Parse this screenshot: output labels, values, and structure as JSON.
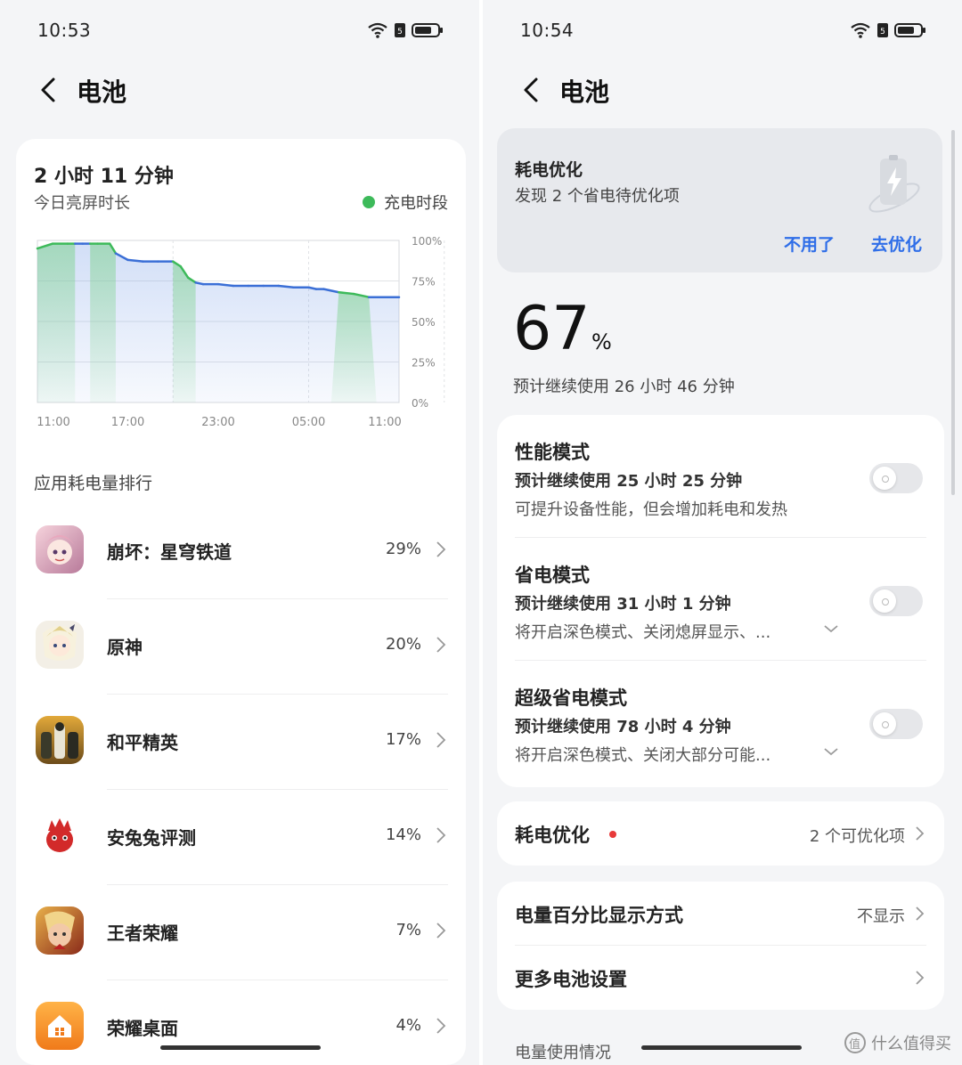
{
  "left": {
    "status": {
      "time": "10:53"
    },
    "header": {
      "title": "电池"
    },
    "usage": {
      "screen_time": "2 小时 11 分钟",
      "screen_time_label": "今日亮屏时长",
      "legend_label": "充电时段",
      "legend_color": "#3dba5a"
    },
    "chart_data": {
      "type": "area",
      "x_ticks": [
        "11:00",
        "17:00",
        "23:00",
        "05:00",
        "11:00"
      ],
      "y_ticks": [
        "100%",
        "75%",
        "50%",
        "25%",
        "0%"
      ],
      "ylim": [
        0,
        100
      ],
      "x": [
        0,
        1,
        2,
        2.5,
        3,
        3.5,
        4,
        4.8,
        5.2,
        6,
        7,
        8,
        9,
        9.5,
        10,
        10.5,
        11,
        12,
        13,
        14,
        15,
        16,
        17,
        18,
        18.5,
        19,
        20,
        21,
        22,
        23,
        24
      ],
      "values": [
        95,
        98,
        98,
        98,
        98,
        98,
        98,
        98,
        92,
        88,
        87,
        87,
        87,
        84,
        77,
        74,
        73,
        73,
        72,
        72,
        72,
        72,
        71,
        71,
        70,
        70,
        68,
        67,
        65,
        65,
        65
      ],
      "charging_periods": [
        [
          0,
          2.5
        ],
        [
          3.5,
          5.2
        ],
        [
          9,
          10.5
        ],
        [
          19.5,
          22.5
        ]
      ]
    },
    "ranking_title": "应用耗电量排行",
    "apps": [
      {
        "name": "崩坏：星穹铁道",
        "percent": "29%",
        "icon": "honkai-star-rail-icon"
      },
      {
        "name": "原神",
        "percent": "20%",
        "icon": "genshin-impact-icon"
      },
      {
        "name": "和平精英",
        "percent": "17%",
        "icon": "peacekeeper-elite-icon"
      },
      {
        "name": "安兔兔评测",
        "percent": "14%",
        "icon": "antutu-icon"
      },
      {
        "name": "王者荣耀",
        "percent": "7%",
        "icon": "honor-of-kings-icon"
      },
      {
        "name": "荣耀桌面",
        "percent": "4%",
        "icon": "honor-launcher-icon"
      }
    ]
  },
  "right": {
    "status": {
      "time": "10:54"
    },
    "header": {
      "title": "电池"
    },
    "optimization_banner": {
      "title": "耗电优化",
      "description": "发现 2 个省电待优化项",
      "dismiss_label": "不用了",
      "optimize_label": "去优化",
      "accent_color": "#2f6ee8"
    },
    "battery": {
      "percent": "67",
      "unit": "%",
      "estimate": "预计继续使用 26 小时 46 分钟"
    },
    "modes": [
      {
        "title": "性能模式",
        "estimate": "预计继续使用 25 小时 25 分钟",
        "description": "可提升设备性能，但会增加耗电和发热",
        "enabled": false,
        "expandable": false
      },
      {
        "title": "省电模式",
        "estimate": "预计继续使用 31 小时 1 分钟",
        "description": "将开启深色模式、关闭熄屏显示、...",
        "enabled": false,
        "expandable": true
      },
      {
        "title": "超级省电模式",
        "estimate": "预计继续使用 78 小时 4 分钟",
        "description": "将开启深色模式、关闭大部分可能...",
        "enabled": false,
        "expandable": true
      }
    ],
    "power_optimization": {
      "title": "耗电优化",
      "value": "2 个可优化项"
    },
    "settings": [
      {
        "title": "电量百分比显示方式",
        "value": "不显示"
      },
      {
        "title": "更多电池设置",
        "value": ""
      }
    ],
    "footer_section": "电量使用情况"
  },
  "watermark": "什么值得买"
}
